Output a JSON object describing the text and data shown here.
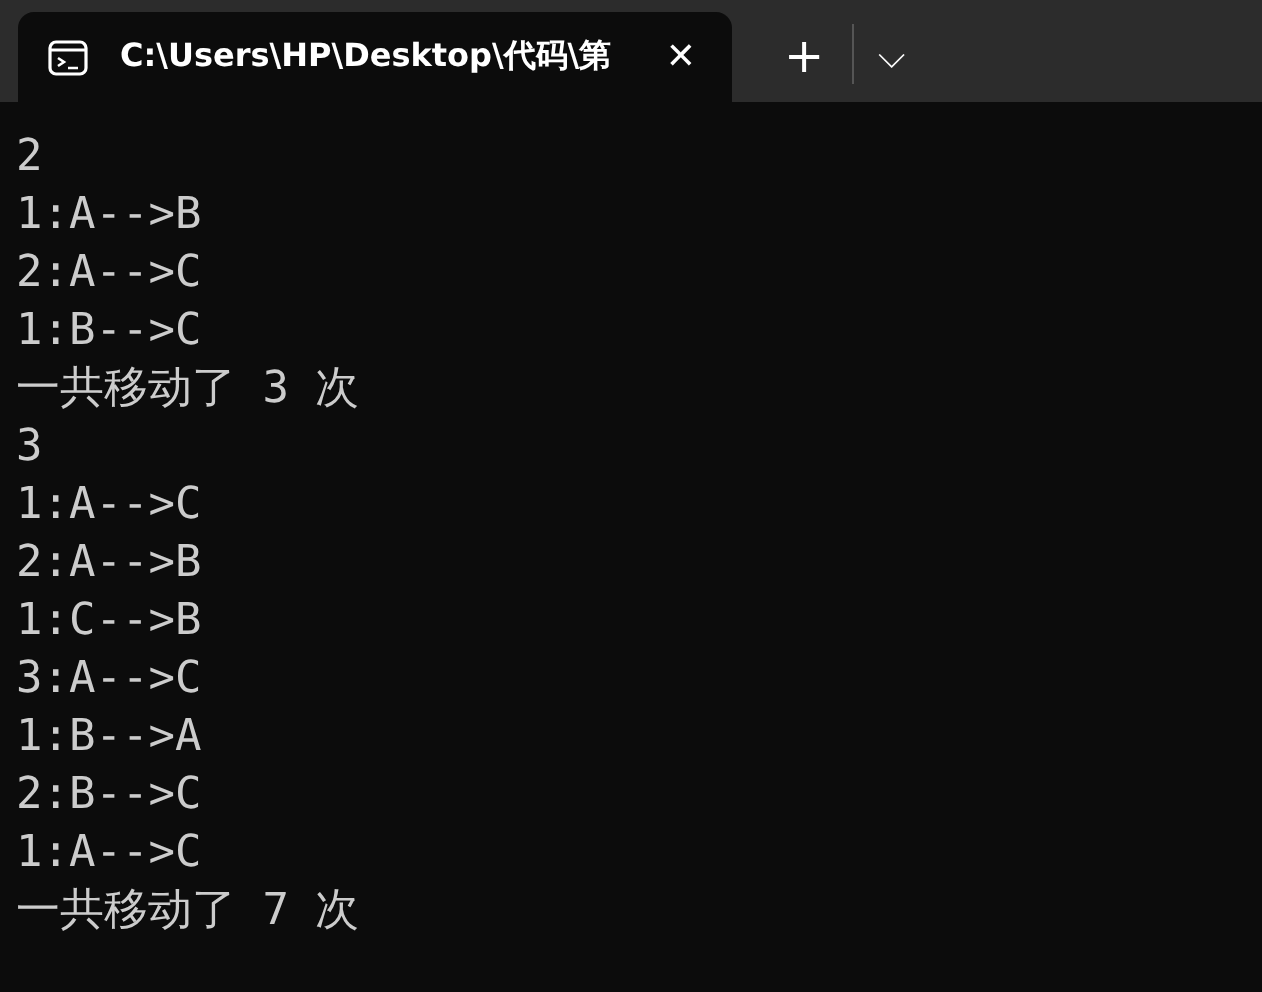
{
  "tab": {
    "title": "C:\\Users\\HP\\Desktop\\代码\\第",
    "selected": true,
    "close": "✕"
  },
  "new_tab": "+",
  "dropdown": "⌵",
  "console_lines": [
    "2",
    "1:A-->B",
    "2:A-->C",
    "1:B-->C",
    "一共移动了 3 次",
    "3",
    "1:A-->C",
    "2:A-->B",
    "1:C-->B",
    "3:A-->C",
    "1:B-->A",
    "2:B-->C",
    "1:A-->C",
    "一共移动了 7 次"
  ]
}
